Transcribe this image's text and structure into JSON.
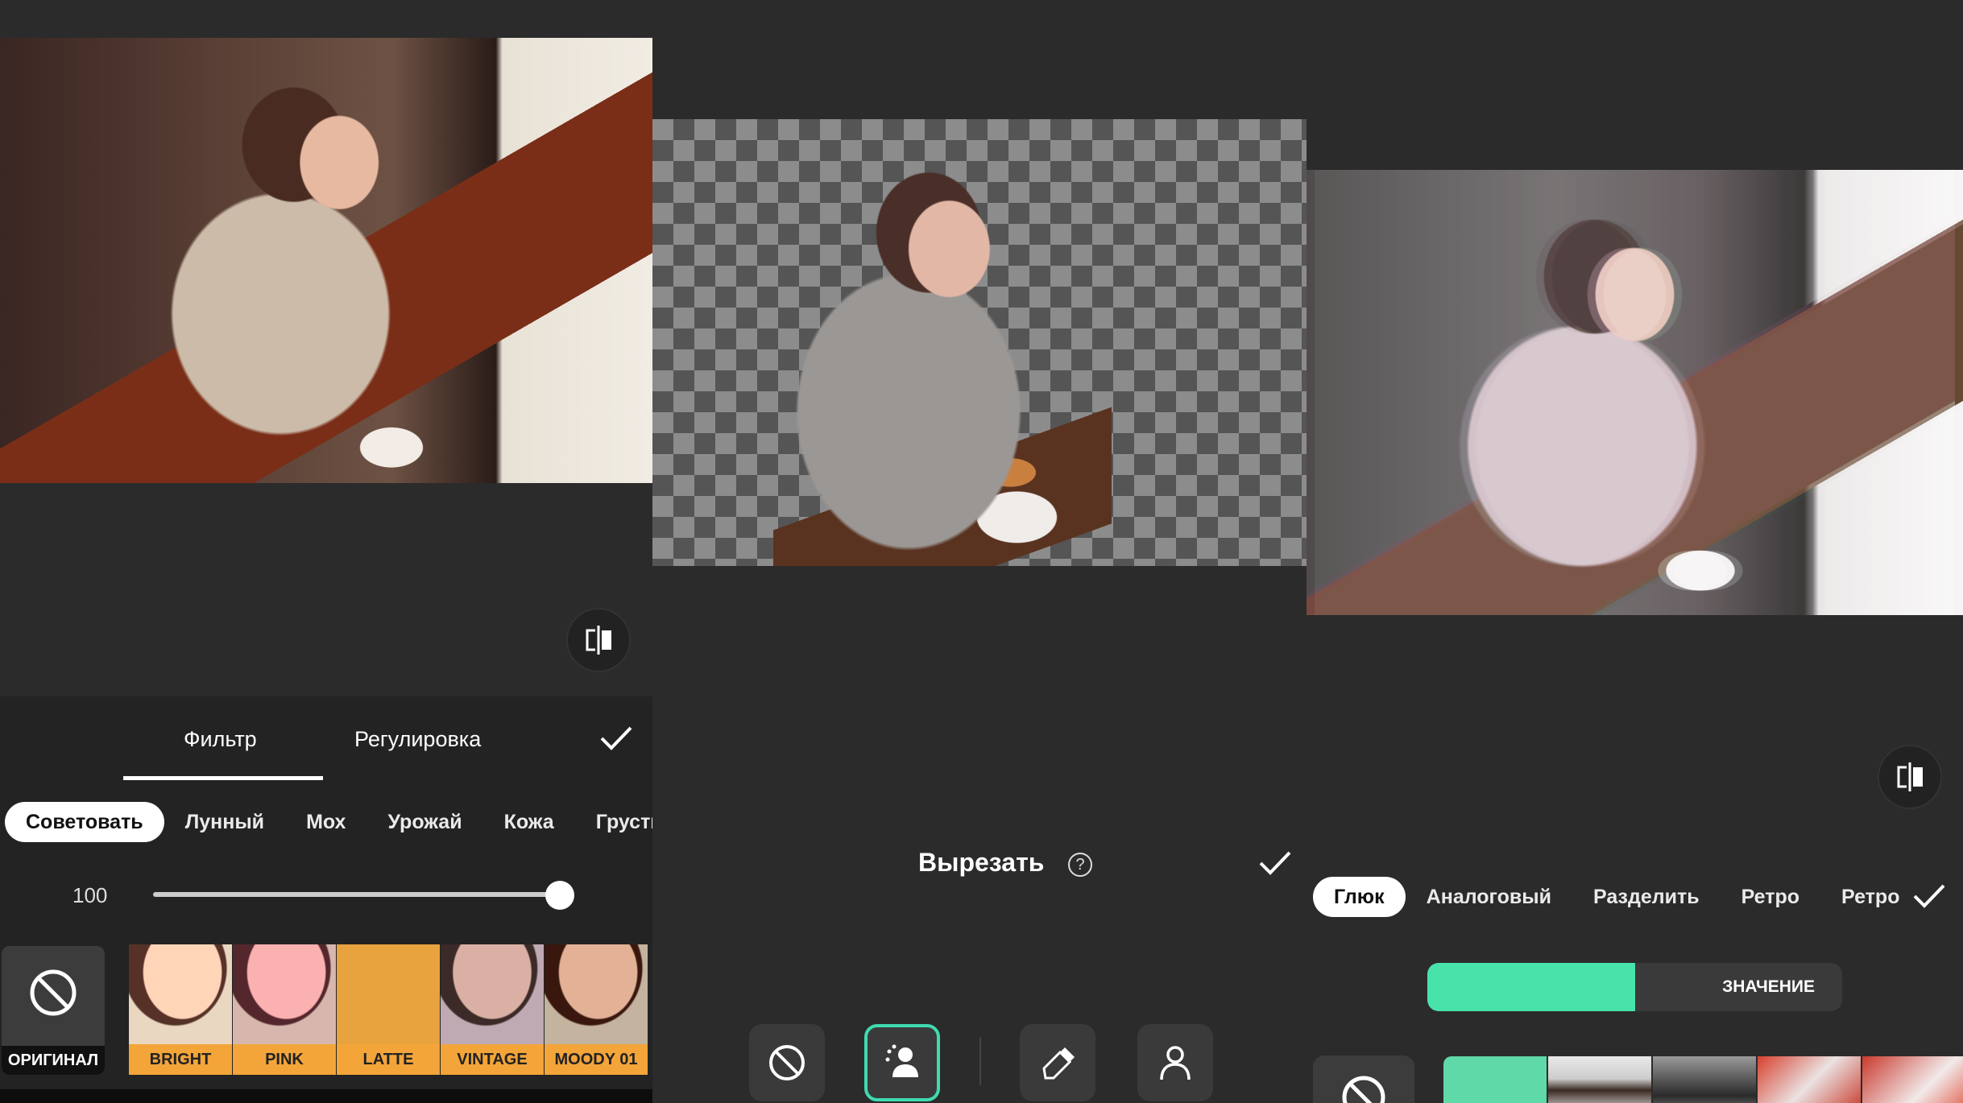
{
  "panel_filter": {
    "tabs": [
      {
        "label": "Фильтр",
        "active": true
      },
      {
        "label": "Регулировка",
        "active": false
      }
    ],
    "categories": [
      "Советовать",
      "Лунный",
      "Мох",
      "Урожай",
      "Кожа",
      "Грусть"
    ],
    "active_category": "Советовать",
    "intensity": "100",
    "intensity_fraction": 1.0,
    "original_label": "ОРИГИНАЛ",
    "filters": [
      "BRIGHT",
      "PINK",
      "LATTE",
      "VINTAGE",
      "MOODY 01"
    ],
    "accent_color": "#f3a539"
  },
  "panel_cutout": {
    "title": "Вырезать",
    "help_symbol": "?",
    "tools": [
      {
        "icon": "no-icon",
        "selected": false
      },
      {
        "icon": "auto-person-icon",
        "selected": true
      },
      {
        "icon": "eraser-icon",
        "selected": false
      },
      {
        "icon": "person-outline-icon",
        "selected": false
      }
    ],
    "accent_color": "#3fdbb0"
  },
  "panel_effects": {
    "categories": [
      "Глюк",
      "Аналоговый",
      "Разделить",
      "Ретро",
      "Ретро"
    ],
    "active_category": "Глюк",
    "value_label": "ЗНАЧЕНИЕ",
    "value_fraction": 0.5,
    "accent_color": "#48e3ab"
  }
}
